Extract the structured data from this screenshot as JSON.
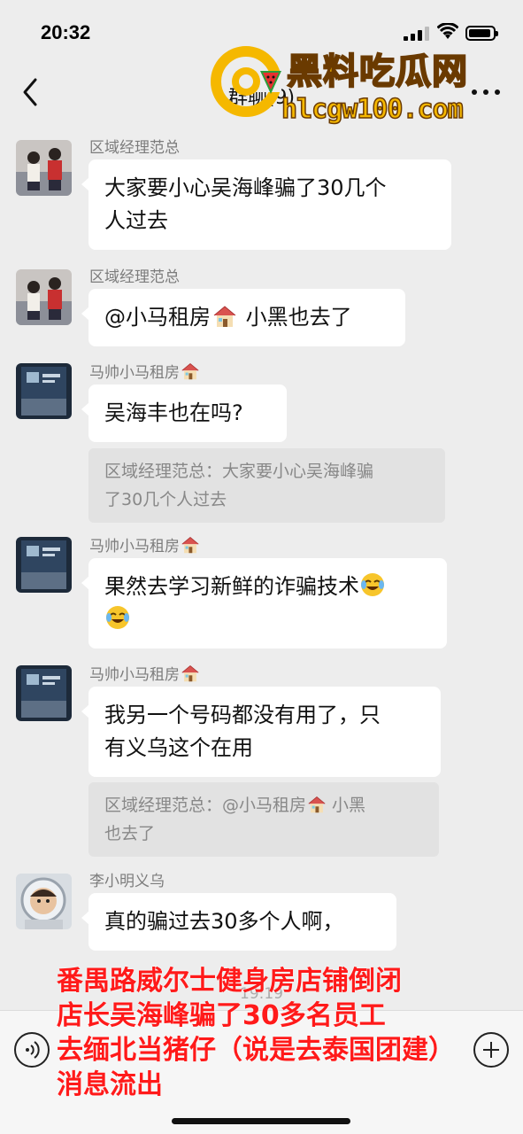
{
  "status": {
    "time": "20:32"
  },
  "header": {
    "title": "群聊(9)"
  },
  "watermark": {
    "name": "黑料吃瓜网",
    "url": "hlcgw100.com"
  },
  "messages": [
    {
      "sender": "区域经理范总",
      "text_lines": [
        "大家要小心吴海峰骗了30几个",
        "人过去"
      ]
    },
    {
      "sender": "区域经理范总",
      "text_a": "@小马租房",
      "text_b": " 小黑也去了"
    },
    {
      "sender": "马帅小马租房",
      "text": "吴海丰也在吗?",
      "quote_lines": [
        "区域经理范总：大家要小心吴海峰骗",
        "了30几个人过去"
      ]
    },
    {
      "sender": "马帅小马租房",
      "text": "果然去学习新鲜的诈骗技术"
    },
    {
      "sender": "马帅小马租房",
      "text_lines": [
        "我另一个号码都没有用了，只",
        "有义乌这个在用"
      ],
      "quote_a": "区域经理范总：@小马租房",
      "quote_b": " 小黑",
      "quote_c": "也去了"
    },
    {
      "sender": "李小明义乌",
      "text": "真的骗过去30多个人啊，"
    }
  ],
  "timestamp": "19:19",
  "caption": {
    "lines": [
      "番禺路威尔士健身房店铺倒闭",
      "店长吴海峰骗了30多名员工",
      "去缅北当猪仔（说是去泰国团建）",
      "消息流出"
    ]
  },
  "colors": {
    "caption": "#ff1a1a",
    "background": "#ededed",
    "bubble": "#ffffff",
    "quote": "#e2e2e2",
    "watermark": "#f5b800"
  },
  "icons": [
    "back-arrow-icon",
    "more-icon",
    "house-emoji",
    "crying-laughing-emoji",
    "voice-icon",
    "add-icon"
  ]
}
